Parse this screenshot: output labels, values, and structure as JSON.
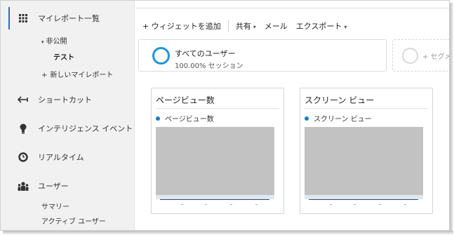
{
  "sidebar": {
    "reports": "マイレポート一覧",
    "private_group": "非公開",
    "report_test": "テスト",
    "new_report": "新しいマイレポート",
    "shortcuts": "ショートカット",
    "intelligence": "インテリジェンス イベント",
    "realtime": "リアルタイム",
    "users": "ユーザー",
    "summary": "サマリー",
    "active_users": "アクティブ ユーザー",
    "accent_color": "#1a73c9"
  },
  "toolbar": {
    "add_widget": "+ ウィジェットを追加",
    "share": "共有",
    "mail": "メール",
    "export": "エクスポート"
  },
  "segment": {
    "title": "すべてのユーザー",
    "subtitle": "100.00% セッション",
    "add_label": "+ セグメ",
    "ring_color": "#2196d6"
  },
  "widgets": [
    {
      "title": "ページビュー数",
      "legend": "ページビュー数"
    },
    {
      "title": "スクリーン ビュー",
      "legend": "スクリーン ビュー"
    }
  ]
}
